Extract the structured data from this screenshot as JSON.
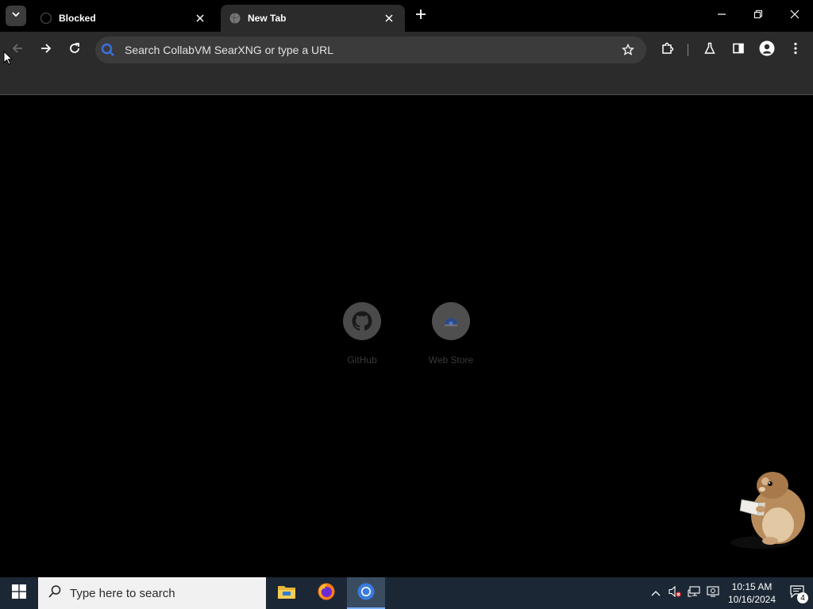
{
  "browser": {
    "tabs": [
      {
        "title": "Blocked",
        "active": false,
        "favicon": "github-icon"
      },
      {
        "title": "New Tab",
        "active": true,
        "favicon": "globe-icon"
      }
    ],
    "omnibox": {
      "placeholder": "Search CollabVM SearXNG or type a URL",
      "value": ""
    }
  },
  "newtab": {
    "shortcuts": [
      {
        "label": "GitHub",
        "icon": "github-icon"
      },
      {
        "label": "Web Store",
        "icon": "webstore-icon"
      }
    ]
  },
  "taskbar": {
    "search_placeholder": "Type here to search",
    "apps": [
      "file-explorer-icon",
      "firefox-icon",
      "chrome-icon"
    ],
    "clock": {
      "time": "10:15 AM",
      "date": "10/16/2024"
    },
    "notifications": "4"
  },
  "colors": {
    "toolbar": "#2b2b2b",
    "tab_active": "#2b2b2b",
    "taskbar": "#1b2735",
    "content_bg": "#000000"
  }
}
